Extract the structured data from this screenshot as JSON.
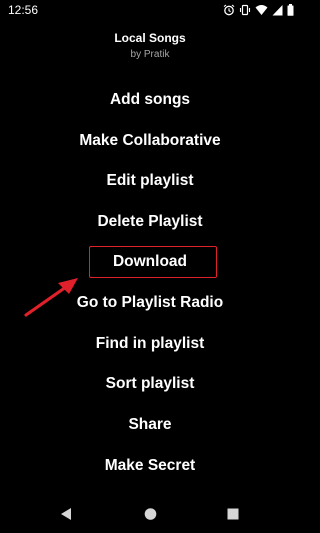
{
  "status_bar": {
    "time": "12:56",
    "icons": [
      "alarm-icon",
      "vibrate-icon",
      "wifi-icon",
      "signal-icon",
      "battery-icon"
    ]
  },
  "header": {
    "title": "Local Songs",
    "owner": "by Pratik"
  },
  "menu": {
    "items": [
      {
        "label": "Add songs"
      },
      {
        "label": "Make Collaborative"
      },
      {
        "label": "Edit playlist"
      },
      {
        "label": "Delete Playlist"
      },
      {
        "label": "Download"
      },
      {
        "label": "Go to Playlist Radio"
      },
      {
        "label": "Find in playlist"
      },
      {
        "label": "Sort playlist"
      },
      {
        "label": "Share"
      },
      {
        "label": "Make Secret"
      }
    ]
  },
  "annotation": {
    "highlight_color": "#e0202a"
  },
  "nav_bar": {
    "buttons": [
      "back-icon",
      "home-icon",
      "recents-icon"
    ]
  }
}
